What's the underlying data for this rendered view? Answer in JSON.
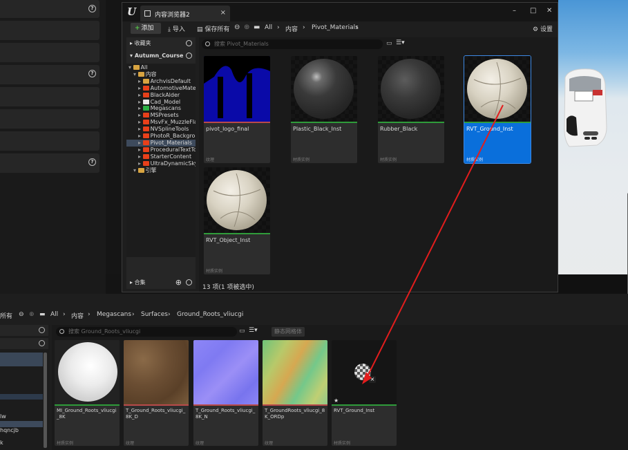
{
  "left_panel": {
    "help_icons": [
      "?",
      "?",
      "?"
    ],
    "labels": [
      "lw",
      "hqncjb",
      "k"
    ]
  },
  "window": {
    "tab_title": "内容浏览器2",
    "tab_close": "×",
    "controls": {
      "minimize": "–",
      "maximize": "□",
      "close": "✕"
    },
    "toolbar": {
      "add_label": "添加",
      "import_label": "导入",
      "save_all_label": "保存所有",
      "breadcrumb": [
        "All",
        "内容",
        "Pivot_Materials"
      ],
      "settings_label": "设置"
    },
    "sources": {
      "favorites": "收藏夹",
      "project": "Autumn_Course",
      "collections": "合集",
      "tree": [
        {
          "label": "All",
          "level": 0,
          "color": "#d8a441"
        },
        {
          "label": "内容",
          "level": 1,
          "color": "#d8a441"
        },
        {
          "label": "ArchvisDefault",
          "level": 2,
          "color": "#d8a441"
        },
        {
          "label": "AutomotiveMater",
          "level": 2,
          "color": "#e8401a"
        },
        {
          "label": "BlackAlder",
          "level": 2,
          "color": "#e8401a"
        },
        {
          "label": "Cad_Model",
          "level": 2,
          "color": "#e9e9e9"
        },
        {
          "label": "Megascans",
          "level": 2,
          "color": "#2cb045"
        },
        {
          "label": "MSPresets",
          "level": 2,
          "color": "#e8401a"
        },
        {
          "label": "MsvFx_MuzzleFla",
          "level": 2,
          "color": "#e8401a"
        },
        {
          "label": "NVSplineTools",
          "level": 2,
          "color": "#e8401a"
        },
        {
          "label": "PhotoR_Backgrou",
          "level": 2,
          "color": "#e8401a"
        },
        {
          "label": "Pivot_Materials",
          "level": 2,
          "color": "#e8401a",
          "selected": true
        },
        {
          "label": "ProceduralTextTo",
          "level": 2,
          "color": "#e8401a"
        },
        {
          "label": "StarterContent",
          "level": 2,
          "color": "#e8401a"
        },
        {
          "label": "UltraDynamicSky",
          "level": 2,
          "color": "#e8401a"
        },
        {
          "label": "引擎",
          "level": 1,
          "color": "#d8a441"
        }
      ]
    },
    "search_placeholder": "搜索 Pivot_Materials",
    "assets": [
      {
        "name": "pivot_logo_final",
        "type": "纹理",
        "stripe": "#b94a4a",
        "kind": "logo"
      },
      {
        "name": "Plastic_Black_Inst",
        "type": "材质实例",
        "stripe": "#2f9c3a",
        "kind": "plastic"
      },
      {
        "name": "Rubber_Black",
        "type": "材质实例",
        "stripe": "#2f9c3a",
        "kind": "rubber"
      },
      {
        "name": "RVT_Ground_Inst",
        "type": "材质实例",
        "stripe": "#2f9c3a",
        "kind": "leather",
        "selected": true
      },
      {
        "name": "RVT_Object_Inst",
        "type": "材质实例",
        "stripe": "#2f9c3a",
        "kind": "leather"
      }
    ],
    "status": "13 项(1 项被选中)"
  },
  "bottom": {
    "save_all_label": "所有",
    "breadcrumb": [
      "All",
      "内容",
      "Megascans",
      "Surfaces",
      "Ground_Roots_vliucgi"
    ],
    "search_placeholder": "搜索 Ground_Roots_vliucgi",
    "filter_label": "静态网格体",
    "assets": [
      {
        "name": "MI_Ground_Roots_vliucgi_8K",
        "type": "材质实例",
        "stripe": "#2f9c3a",
        "kind": "white"
      },
      {
        "name": "T_Ground_Roots_vliucgi_8K_D",
        "type": "纹理",
        "stripe": "#b94a4a",
        "kind": "soil"
      },
      {
        "name": "T_Ground_Roots_vliucgi_8K_N",
        "type": "纹理",
        "stripe": "#b94a4a",
        "kind": "normal"
      },
      {
        "name": "T_GroundRoots_vliucgi_8K_ORDp",
        "type": "纹理",
        "stripe": "#b94a4a",
        "kind": "ordp"
      },
      {
        "name": "RVT_Ground_Inst",
        "type": "材质实例",
        "stripe": "#2f9c3a",
        "kind": "dragging"
      }
    ]
  }
}
